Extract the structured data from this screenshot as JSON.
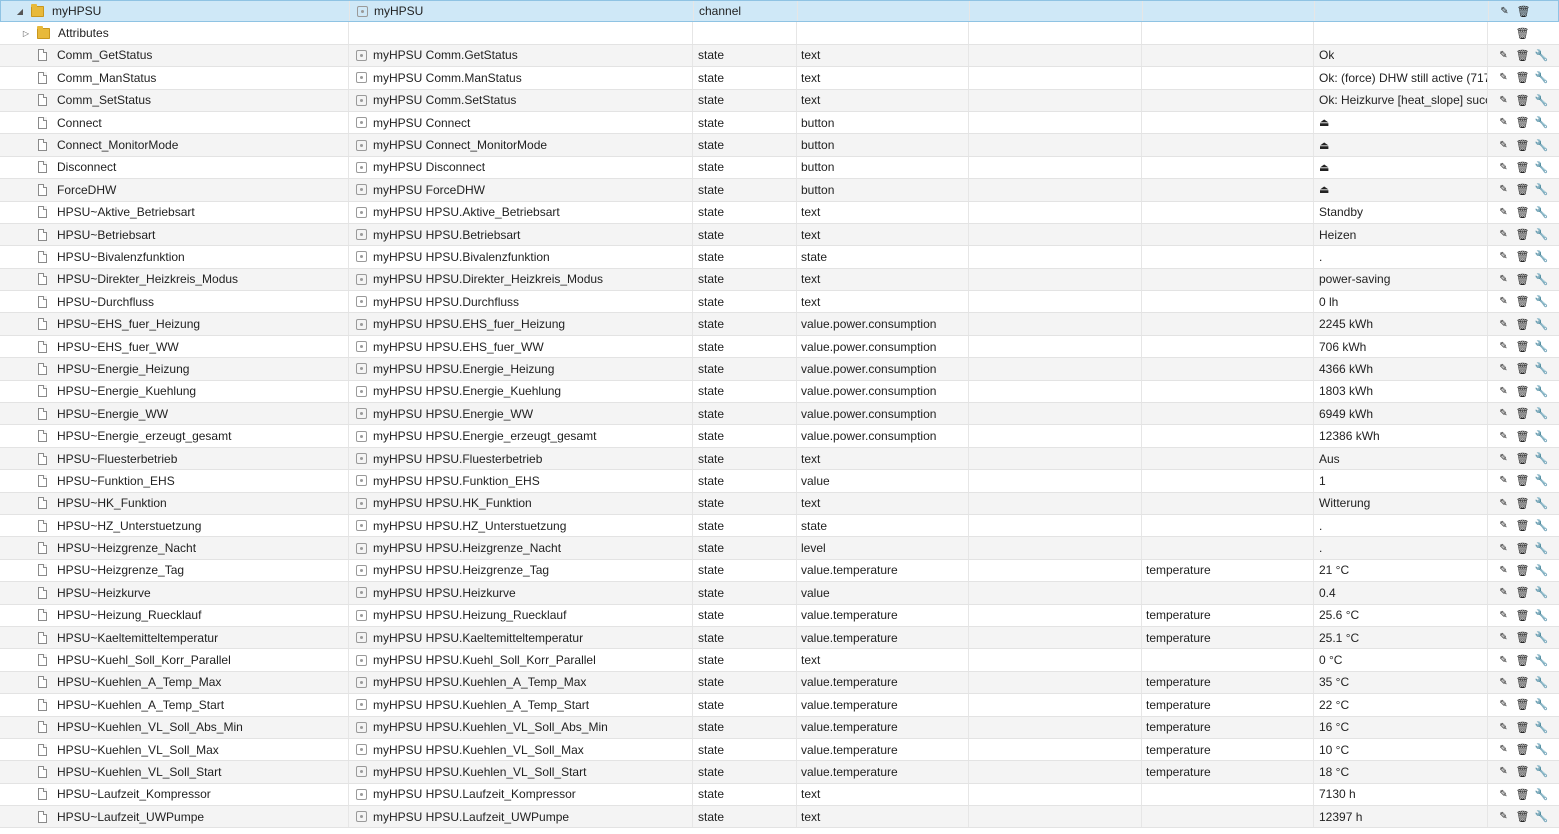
{
  "root": {
    "id": "myHPSU",
    "name": "myHPSU",
    "type": "channel"
  },
  "attributes": {
    "id": "Attributes"
  },
  "icons": {
    "edit": "pencil-icon",
    "delete": "trash-icon",
    "settings": "wrench-icon",
    "button_value": "eject-icon"
  },
  "rows": [
    {
      "id": "Comm_GetStatus",
      "name": "myHPSU Comm.GetStatus",
      "type": "state",
      "role": "text",
      "func": "",
      "value": "Ok"
    },
    {
      "id": "Comm_ManStatus",
      "name": "myHPSU Comm.ManStatus",
      "type": "state",
      "role": "text",
      "func": "",
      "value": "Ok: (force) DHW still active (717"
    },
    {
      "id": "Comm_SetStatus",
      "name": "myHPSU Comm.SetStatus",
      "type": "state",
      "role": "text",
      "func": "",
      "value": "Ok: Heizkurve [heat_slope] succ"
    },
    {
      "id": "Connect",
      "name": "myHPSU Connect",
      "type": "state",
      "role": "button",
      "func": "",
      "value": "⏏"
    },
    {
      "id": "Connect_MonitorMode",
      "name": "myHPSU Connect_MonitorMode",
      "type": "state",
      "role": "button",
      "func": "",
      "value": "⏏"
    },
    {
      "id": "Disconnect",
      "name": "myHPSU Disconnect",
      "type": "state",
      "role": "button",
      "func": "",
      "value": "⏏"
    },
    {
      "id": "ForceDHW",
      "name": "myHPSU ForceDHW",
      "type": "state",
      "role": "button",
      "func": "",
      "value": "⏏"
    },
    {
      "id": "HPSU~Aktive_Betriebsart",
      "name": "myHPSU HPSU.Aktive_Betriebsart",
      "type": "state",
      "role": "text",
      "func": "",
      "value": "Standby"
    },
    {
      "id": "HPSU~Betriebsart",
      "name": "myHPSU HPSU.Betriebsart",
      "type": "state",
      "role": "text",
      "func": "",
      "value": "Heizen"
    },
    {
      "id": "HPSU~Bivalenzfunktion",
      "name": "myHPSU HPSU.Bivalenzfunktion",
      "type": "state",
      "role": "state",
      "func": "",
      "value": "."
    },
    {
      "id": "HPSU~Direkter_Heizkreis_Modus",
      "name": "myHPSU HPSU.Direkter_Heizkreis_Modus",
      "type": "state",
      "role": "text",
      "func": "",
      "value": "power-saving"
    },
    {
      "id": "HPSU~Durchfluss",
      "name": "myHPSU HPSU.Durchfluss",
      "type": "state",
      "role": "text",
      "func": "",
      "value": "0 lh"
    },
    {
      "id": "HPSU~EHS_fuer_Heizung",
      "name": "myHPSU HPSU.EHS_fuer_Heizung",
      "type": "state",
      "role": "value.power.consumption",
      "func": "",
      "value": "2245 kWh"
    },
    {
      "id": "HPSU~EHS_fuer_WW",
      "name": "myHPSU HPSU.EHS_fuer_WW",
      "type": "state",
      "role": "value.power.consumption",
      "func": "",
      "value": "706 kWh"
    },
    {
      "id": "HPSU~Energie_Heizung",
      "name": "myHPSU HPSU.Energie_Heizung",
      "type": "state",
      "role": "value.power.consumption",
      "func": "",
      "value": "4366 kWh"
    },
    {
      "id": "HPSU~Energie_Kuehlung",
      "name": "myHPSU HPSU.Energie_Kuehlung",
      "type": "state",
      "role": "value.power.consumption",
      "func": "",
      "value": "1803 kWh"
    },
    {
      "id": "HPSU~Energie_WW",
      "name": "myHPSU HPSU.Energie_WW",
      "type": "state",
      "role": "value.power.consumption",
      "func": "",
      "value": "6949 kWh"
    },
    {
      "id": "HPSU~Energie_erzeugt_gesamt",
      "name": "myHPSU HPSU.Energie_erzeugt_gesamt",
      "type": "state",
      "role": "value.power.consumption",
      "func": "",
      "value": "12386 kWh"
    },
    {
      "id": "HPSU~Fluesterbetrieb",
      "name": "myHPSU HPSU.Fluesterbetrieb",
      "type": "state",
      "role": "text",
      "func": "",
      "value": "Aus"
    },
    {
      "id": "HPSU~Funktion_EHS",
      "name": "myHPSU HPSU.Funktion_EHS",
      "type": "state",
      "role": "value",
      "func": "",
      "value": "1"
    },
    {
      "id": "HPSU~HK_Funktion",
      "name": "myHPSU HPSU.HK_Funktion",
      "type": "state",
      "role": "text",
      "func": "",
      "value": "Witterung"
    },
    {
      "id": "HPSU~HZ_Unterstuetzung",
      "name": "myHPSU HPSU.HZ_Unterstuetzung",
      "type": "state",
      "role": "state",
      "func": "",
      "value": "."
    },
    {
      "id": "HPSU~Heizgrenze_Nacht",
      "name": "myHPSU HPSU.Heizgrenze_Nacht",
      "type": "state",
      "role": "level",
      "func": "",
      "value": "."
    },
    {
      "id": "HPSU~Heizgrenze_Tag",
      "name": "myHPSU HPSU.Heizgrenze_Tag",
      "type": "state",
      "role": "value.temperature",
      "func": "temperature",
      "value": "21 °C"
    },
    {
      "id": "HPSU~Heizkurve",
      "name": "myHPSU HPSU.Heizkurve",
      "type": "state",
      "role": "value",
      "func": "",
      "value": "0.4"
    },
    {
      "id": "HPSU~Heizung_Ruecklauf",
      "name": "myHPSU HPSU.Heizung_Ruecklauf",
      "type": "state",
      "role": "value.temperature",
      "func": "temperature",
      "value": "25.6 °C"
    },
    {
      "id": "HPSU~Kaeltemitteltemperatur",
      "name": "myHPSU HPSU.Kaeltemitteltemperatur",
      "type": "state",
      "role": "value.temperature",
      "func": "temperature",
      "value": "25.1 °C"
    },
    {
      "id": "HPSU~Kuehl_Soll_Korr_Parallel",
      "name": "myHPSU HPSU.Kuehl_Soll_Korr_Parallel",
      "type": "state",
      "role": "text",
      "func": "",
      "value": "0 °C"
    },
    {
      "id": "HPSU~Kuehlen_A_Temp_Max",
      "name": "myHPSU HPSU.Kuehlen_A_Temp_Max",
      "type": "state",
      "role": "value.temperature",
      "func": "temperature",
      "value": "35 °C"
    },
    {
      "id": "HPSU~Kuehlen_A_Temp_Start",
      "name": "myHPSU HPSU.Kuehlen_A_Temp_Start",
      "type": "state",
      "role": "value.temperature",
      "func": "temperature",
      "value": "22 °C"
    },
    {
      "id": "HPSU~Kuehlen_VL_Soll_Abs_Min",
      "name": "myHPSU HPSU.Kuehlen_VL_Soll_Abs_Min",
      "type": "state",
      "role": "value.temperature",
      "func": "temperature",
      "value": "16 °C"
    },
    {
      "id": "HPSU~Kuehlen_VL_Soll_Max",
      "name": "myHPSU HPSU.Kuehlen_VL_Soll_Max",
      "type": "state",
      "role": "value.temperature",
      "func": "temperature",
      "value": "10 °C"
    },
    {
      "id": "HPSU~Kuehlen_VL_Soll_Start",
      "name": "myHPSU HPSU.Kuehlen_VL_Soll_Start",
      "type": "state",
      "role": "value.temperature",
      "func": "temperature",
      "value": "18 °C"
    },
    {
      "id": "HPSU~Laufzeit_Kompressor",
      "name": "myHPSU HPSU.Laufzeit_Kompressor",
      "type": "state",
      "role": "text",
      "func": "",
      "value": "7130 h"
    },
    {
      "id": "HPSU~Laufzeit_UWPumpe",
      "name": "myHPSU HPSU.Laufzeit_UWPumpe",
      "type": "state",
      "role": "text",
      "func": "",
      "value": "12397 h"
    }
  ]
}
